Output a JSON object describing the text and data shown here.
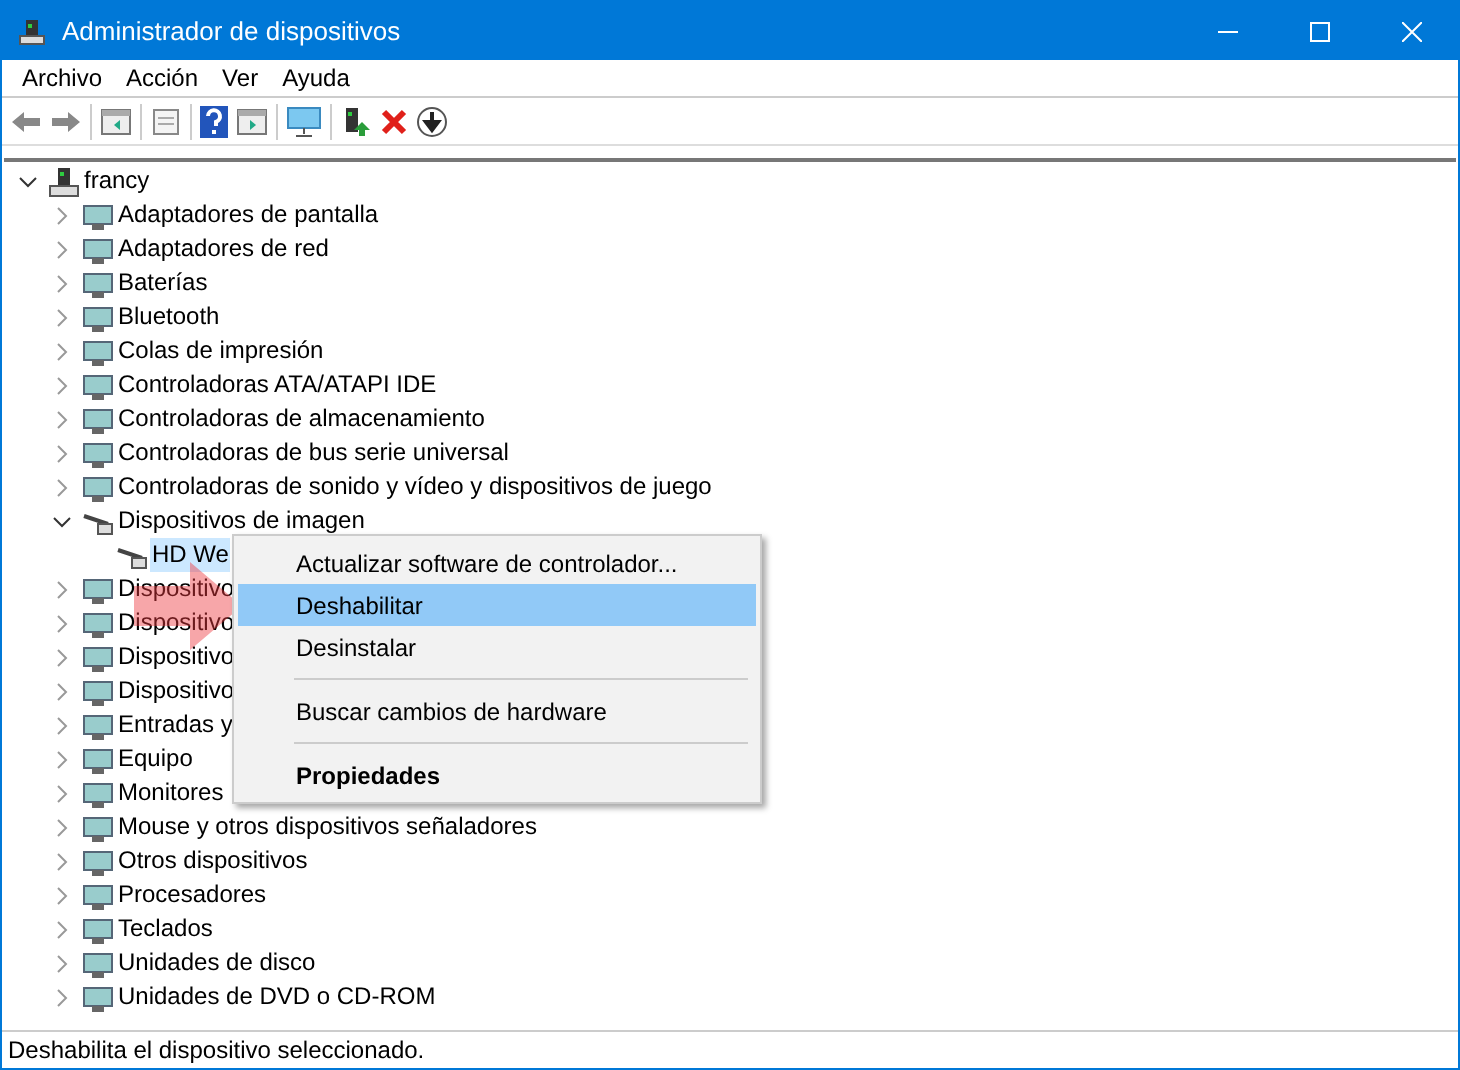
{
  "window": {
    "title": "Administrador de dispositivos"
  },
  "menu_bar": [
    "Archivo",
    "Acción",
    "Ver",
    "Ayuda"
  ],
  "tree": {
    "label": "francy",
    "expanded": true,
    "selected": false,
    "children": [
      {
        "label": "Adaptadores de pantalla",
        "expanded": false,
        "selected": false
      },
      {
        "label": "Adaptadores de red",
        "expanded": false,
        "selected": false
      },
      {
        "label": "Baterías",
        "expanded": false,
        "selected": false
      },
      {
        "label": "Bluetooth",
        "expanded": false,
        "selected": false
      },
      {
        "label": "Colas de impresión",
        "expanded": false,
        "selected": false
      },
      {
        "label": "Controladoras ATA/ATAPI IDE",
        "expanded": false,
        "selected": false
      },
      {
        "label": "Controladoras de almacenamiento",
        "expanded": false,
        "selected": false
      },
      {
        "label": "Controladoras de bus serie universal",
        "expanded": false,
        "selected": false
      },
      {
        "label": "Controladoras de sonido y vídeo y dispositivos de juego",
        "expanded": false,
        "selected": false
      },
      {
        "label": "Dispositivos de imagen",
        "expanded": true,
        "selected": false,
        "children": [
          {
            "label": "HD We",
            "selected": true
          }
        ]
      },
      {
        "label": "Dispositivo",
        "expanded": false,
        "selected": false
      },
      {
        "label": "Dispositivo",
        "expanded": false,
        "selected": false
      },
      {
        "label": "Dispositivo",
        "expanded": false,
        "selected": false
      },
      {
        "label": "Dispositivo",
        "expanded": false,
        "selected": false
      },
      {
        "label": "Entradas y",
        "expanded": false,
        "selected": false
      },
      {
        "label": "Equipo",
        "expanded": false,
        "selected": false
      },
      {
        "label": "Monitores",
        "expanded": false,
        "selected": false
      },
      {
        "label": "Mouse y otros dispositivos señaladores",
        "expanded": false,
        "selected": false
      },
      {
        "label": "Otros dispositivos",
        "expanded": false,
        "selected": false
      },
      {
        "label": "Procesadores",
        "expanded": false,
        "selected": false
      },
      {
        "label": "Teclados",
        "expanded": false,
        "selected": false
      },
      {
        "label": "Unidades de disco",
        "expanded": false,
        "selected": false
      },
      {
        "label": "Unidades de DVD o CD-ROM",
        "expanded": false,
        "selected": false
      }
    ]
  },
  "context_menu": [
    {
      "kind": "item",
      "label": "Actualizar software de controlador...",
      "selected": false
    },
    {
      "kind": "item",
      "label": "Deshabilitar",
      "selected": true
    },
    {
      "kind": "item",
      "label": "Desinstalar",
      "selected": false
    },
    {
      "kind": "separator"
    },
    {
      "kind": "item",
      "label": "Buscar cambios de hardware",
      "selected": false
    },
    {
      "kind": "separator"
    },
    {
      "kind": "default",
      "label": "Propiedades",
      "selected": false
    }
  ],
  "status_bar": "Deshabilita el dispositivo seleccionado."
}
